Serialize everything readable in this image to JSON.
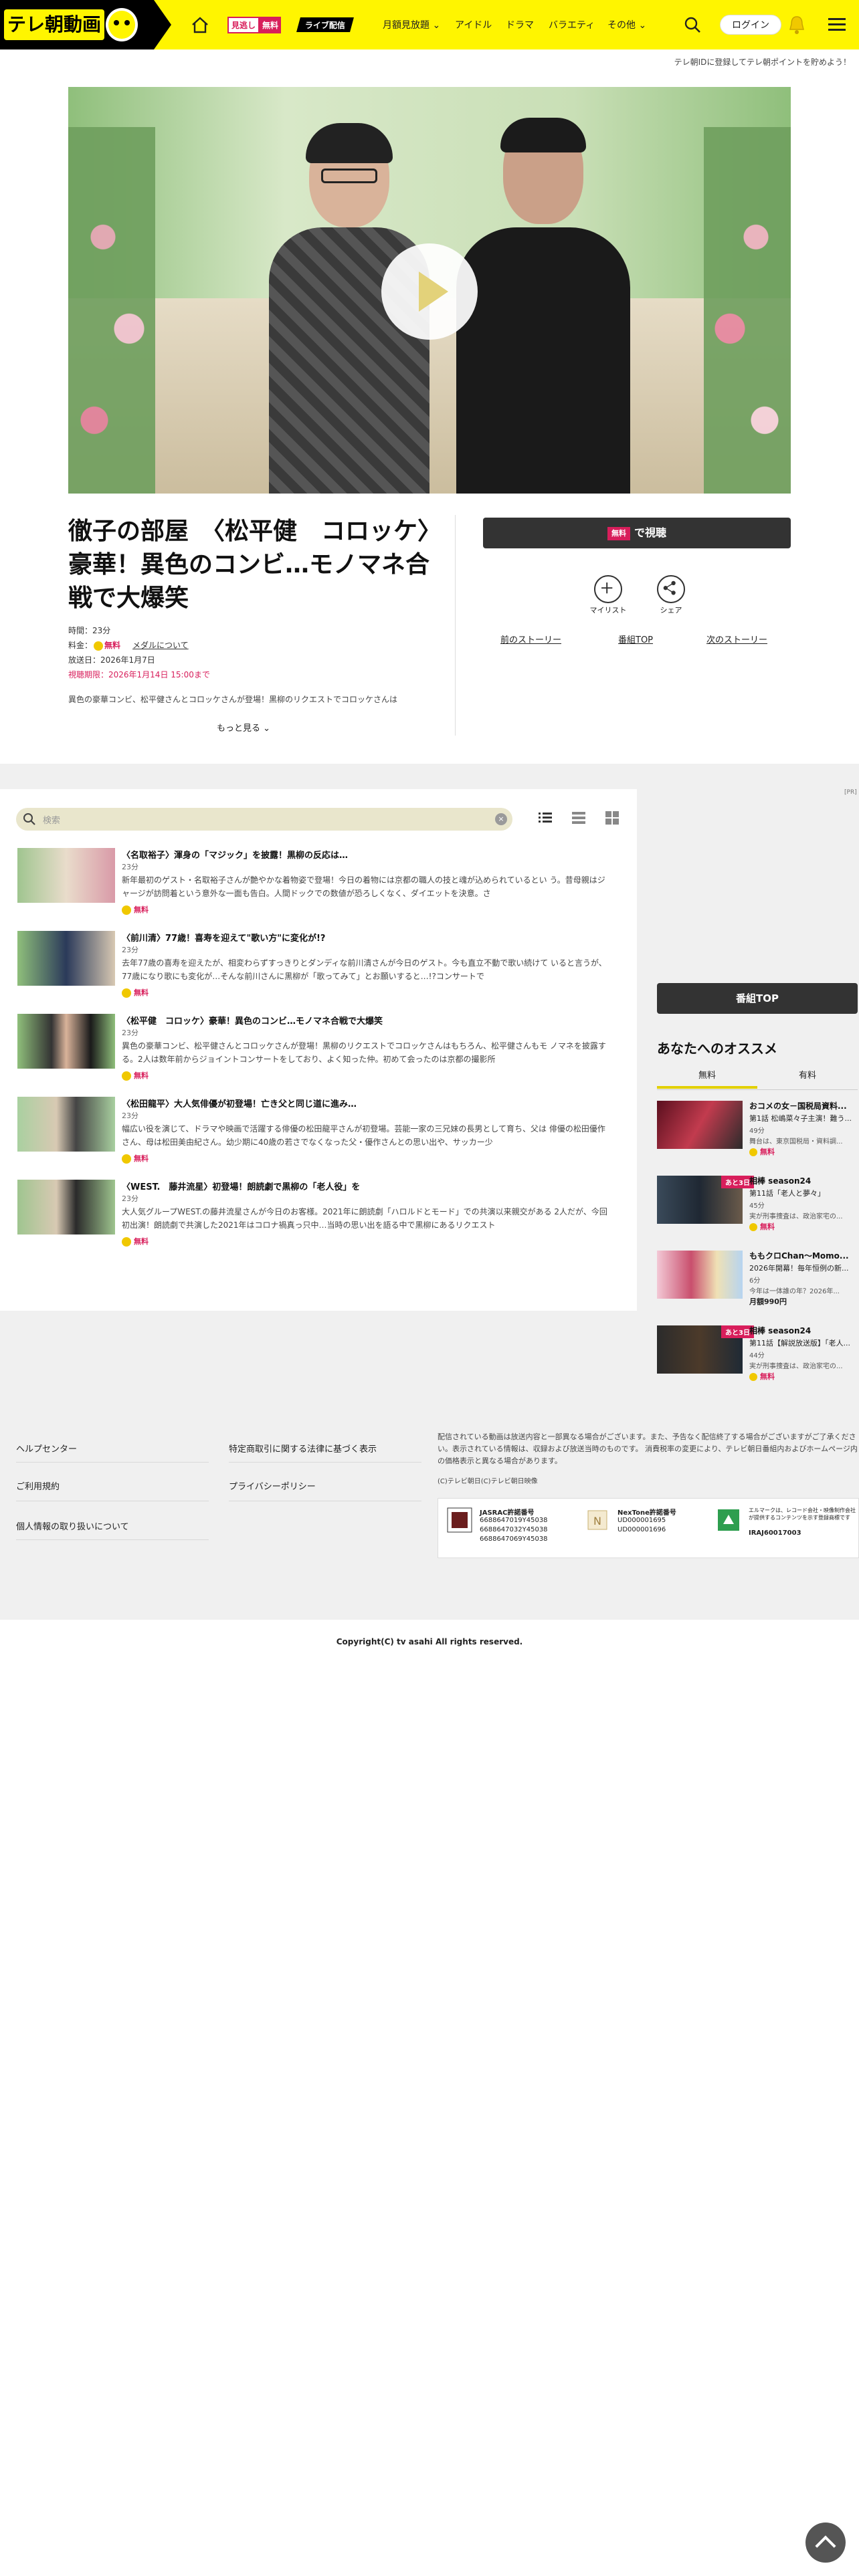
{
  "header": {
    "logo": "テレ朝動画",
    "nav_free_label": "見逃し",
    "nav_free_badge": "無料",
    "nav_live": "ライブ配信",
    "nav_items": [
      "月額見放題",
      "アイドル",
      "ドラマ",
      "バラエティ",
      "その他"
    ],
    "login": "ログイン",
    "promo": "テレ朝IDに登録してテレ朝ポイントを貯めよう！"
  },
  "program": {
    "title": "徹子の部屋　〈松平健　コロッケ〉豪華！異色のコンビ…モノマネ合戦で大爆笑",
    "time_label": "時間：23分",
    "price_prefix": "料金：",
    "price_free": "無料",
    "media_link": "メダルについて",
    "aired": "放送日：2026年1月7日",
    "deadline": "視聴期限：2026年1月14日 15:00まで",
    "description": "異色の豪華コンビ、松平健さんとコロッケさんが登場！黒柳のリクエストでコロッケさんは",
    "more": "もっと見る"
  },
  "actions": {
    "watch_badge": "無料",
    "watch_label": "で視聴",
    "mylist": "マイリスト",
    "share": "シェア",
    "prev_story": "前のストーリー",
    "program_top": "番組TOP",
    "next_story": "次のストーリー"
  },
  "list": {
    "search_placeholder": "検索",
    "clear": "×",
    "ad_tag": "[PR]",
    "episodes": [
      {
        "title": "〈名取裕子〉渾身の「マジック」を披露！黒柳の反応は…",
        "duration": "23分",
        "text": "新年最初のゲスト・名取裕子さんが艶やかな着物姿で登場！今日の着物には京都の職人の技と魂が込められているとい う。昔母親はジャージが訪問着という意外な一面も告白。人間ドックでの数値が恐ろしくなく、ダイエットを決意。さ",
        "free": "無料"
      },
      {
        "title": "〈前川清〉77歳！喜寿を迎えて\"歌い方\"に変化が!?",
        "duration": "23分",
        "text": "去年77歳の喜寿を迎えたが、相変わらずすっきりとダンディな前川清さんが今日のゲスト。今も直立不動で歌い続けて いると言うが、77歳になり歌にも変化が…そんな前川さんに黒柳が「歌ってみて」とお願いすると…!?コンサートで",
        "free": "無料"
      },
      {
        "title": "〈松平健　コロッケ〉豪華！異色のコンビ…モノマネ合戦で大爆笑",
        "duration": "23分",
        "text": "異色の豪華コンビ、松平健さんとコロッケさんが登場！黒柳のリクエストでコロッケさんはもちろん、松平健さんもモ ノマネを披露する。2人は数年前からジョイントコンサートをしており、よく知った仲。初めて会ったのは京都の撮影所",
        "free": "無料"
      },
      {
        "title": "〈松田龍平〉大人気俳優が初登場！亡き父と同じ道に進み…",
        "duration": "23分",
        "text": "幅広い役を演じて、ドラマや映画で活躍する俳優の松田龍平さんが初登場。芸能一家の三兄妹の長男として育ち、父は 俳優の松田優作さん、母は松田美由紀さん。幼少期に40歳の若さでなくなった父・優作さんとの思い出や、サッカー少",
        "free": "無料"
      },
      {
        "title": "〈WEST.　藤井流星〉初登場！朗読劇で黒柳の「老人役」を",
        "duration": "23分",
        "text": "大人気グループWEST.の藤井流星さんが今日のお客様。2021年に朗読劇「ハロルドとモード」での共演以来親交がある 2人だが、今回初出演！朗読劇で共演した2021年はコロナ禍真っ只中…当時の思い出を語る中で黒柳にあるリクエスト",
        "free": "無料"
      }
    ]
  },
  "sidebar": {
    "program_top": "番組TOP",
    "rec_title": "あなたへのオススメ",
    "tab_free": "無料",
    "tab_paid": "有料",
    "items": [
      {
        "title": "おコメの女－国税局資料...",
        "sub": "第1話 松嶋菜々子主演！難う...",
        "duration": "49分",
        "text": "舞台は、東京国税局・資料調...",
        "price": "無料",
        "free": true,
        "ribbon": ""
      },
      {
        "title": "相棒 season24",
        "sub": "第11話「老人と夢々」",
        "duration": "45分",
        "text": "実が刑事捜査は、政治家宅の...",
        "price": "無料",
        "free": true,
        "ribbon": "あと3日"
      },
      {
        "title": "ももクロChan～Momo...",
        "sub": "2026年開幕！毎年恒例の新...",
        "duration": "6分",
        "text": "今年は一体誰の年？2026年...",
        "price": "月額990円",
        "free": false,
        "ribbon": ""
      },
      {
        "title": "相棒 season24",
        "sub": "第11話【解説放送版】「老人...",
        "duration": "44分",
        "text": "実が刑事捜査は、政治家宅の...",
        "price": "無料",
        "free": true,
        "ribbon": "あと3日"
      }
    ]
  },
  "footer": {
    "links_left": [
      "ヘルプセンター",
      "ご利用規約",
      "個人情報の取り扱いについて"
    ],
    "links_mid": [
      "特定商取引に関する法律に基づく表示",
      "プライバシーポリシー"
    ],
    "note": "配信されている動画は放送内容と一部異なる場合がございます。また、予告なく配信終了する場合がございますがご了承ください。表示されている情報は、収録および放送当時のものです。 消費税率の変更により、テレビ朝日番組内およびホームページ内の価格表示と異なる場合があります。",
    "copy_small": "(C)テレビ朝日(C)テレビ朝日映像",
    "jasrac_head": "JASRAC許諾番号",
    "jasrac_values": [
      "6688647019Y45038",
      "6688647032Y45038",
      "6688647069Y45038"
    ],
    "nextone_head": "NexTone許諾番号",
    "nextone_values": [
      "UD000001695",
      "UD000001696"
    ],
    "lmark_text": "エルマークは、レコード会社・映像制作会社が提供するコンテンツを示す登録商標です",
    "lmark_code": "IRAJ60017003",
    "copyright": "Copyright(C) tv asahi All rights reserved."
  }
}
